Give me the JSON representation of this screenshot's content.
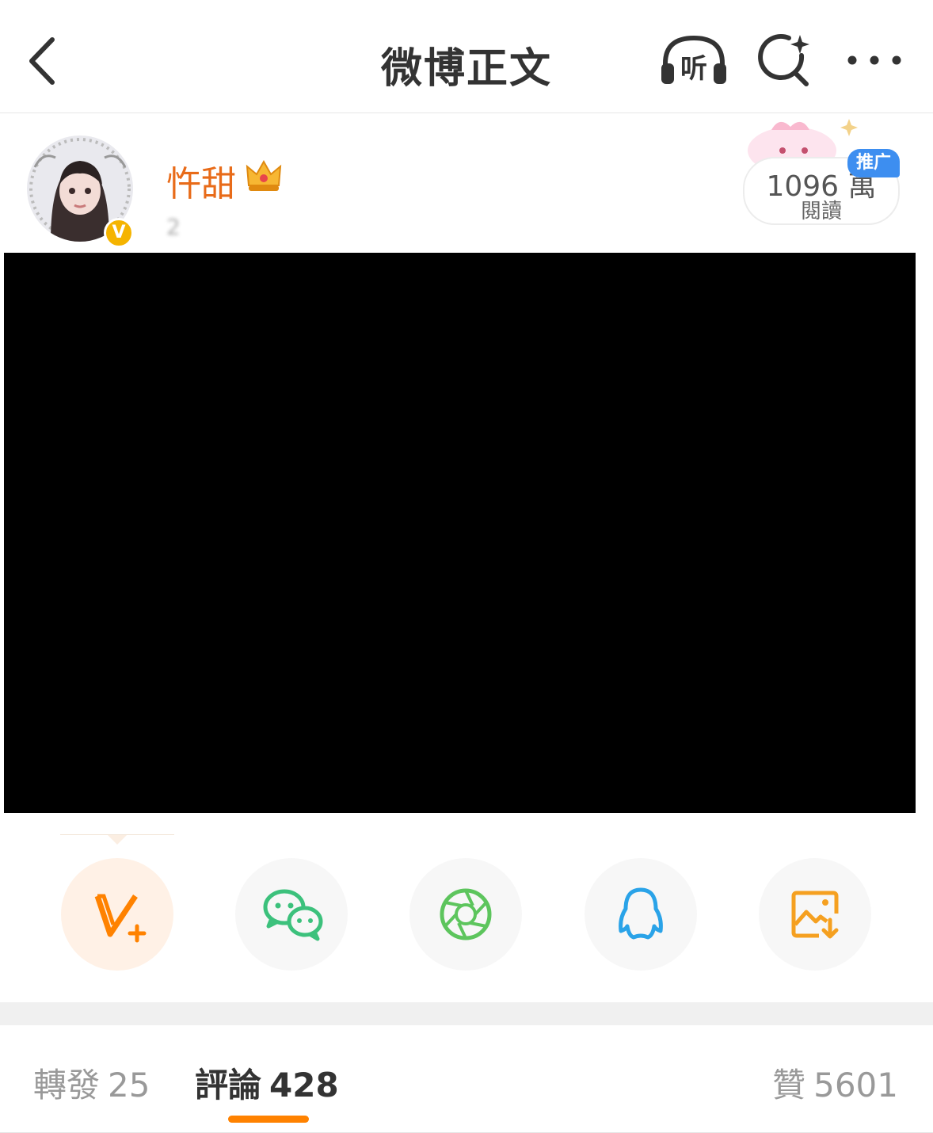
{
  "header": {
    "title": "微博正文",
    "listen_label": "听"
  },
  "post": {
    "username": "忤甜",
    "meta_text": "2",
    "read_count": "1096 萬",
    "read_label": "閱讀",
    "promo_label": "推广",
    "verified_label": "V"
  },
  "share": {
    "items": [
      "weibo-repost",
      "wechat",
      "moments",
      "qq",
      "save-image"
    ]
  },
  "tabs": {
    "repost_label": "轉發",
    "repost_count": "25",
    "comment_label": "評論",
    "comment_count": "428",
    "like_label": "贊",
    "like_count": "5601"
  },
  "colors": {
    "accent": "#ff8200",
    "username": "#e86b19",
    "promo": "#3d8ef0",
    "wechat": "#3cc17c",
    "moments": "#5dc55d",
    "qq": "#2aa3e8",
    "save": "#f5a020"
  }
}
